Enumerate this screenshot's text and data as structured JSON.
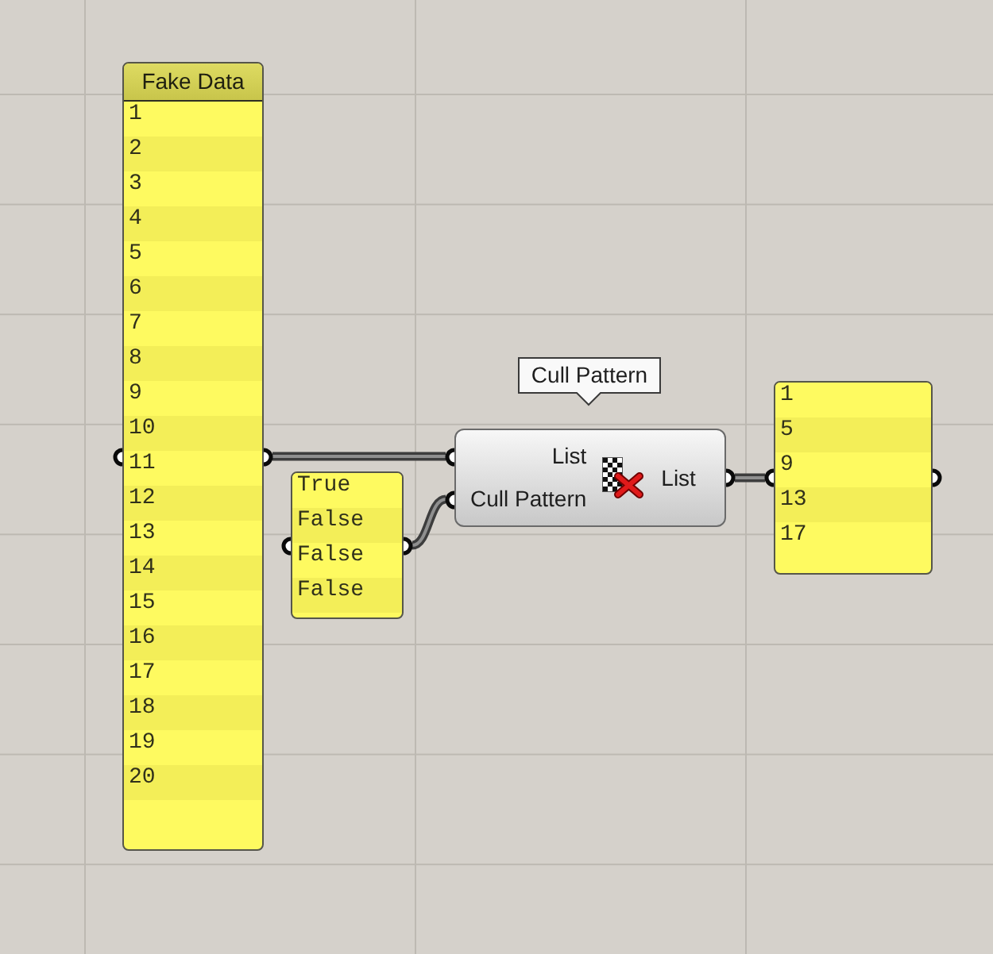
{
  "nodes": [
    {
      "kind": "panel",
      "title": "Fake Data",
      "items": [
        "1",
        "2",
        "3",
        "4",
        "5",
        "6",
        "7",
        "8",
        "9",
        "10",
        "11",
        "12",
        "13",
        "14",
        "15",
        "16",
        "17",
        "18",
        "19",
        "20"
      ]
    },
    {
      "kind": "panel",
      "items": [
        "True",
        "False",
        "False",
        "False"
      ]
    },
    {
      "kind": "component",
      "tooltip": "Cull Pattern",
      "inputs": [
        "List",
        "Cull Pattern"
      ],
      "outputs": [
        "List"
      ]
    },
    {
      "kind": "panel",
      "items": [
        "1",
        "5",
        "9",
        "13",
        "17"
      ]
    }
  ]
}
